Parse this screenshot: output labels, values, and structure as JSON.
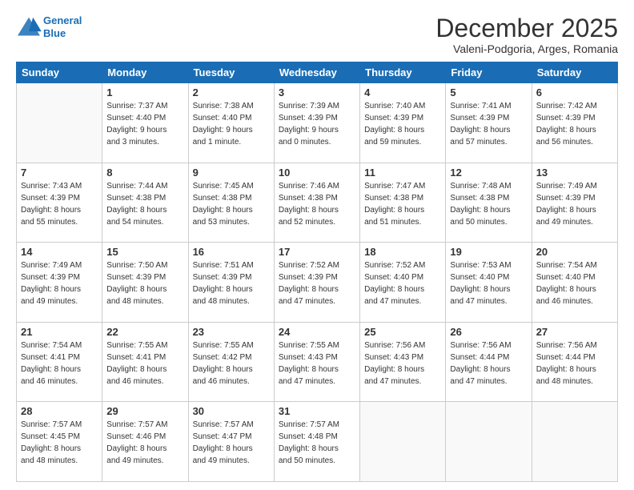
{
  "logo": {
    "line1": "General",
    "line2": "Blue"
  },
  "title": "December 2025",
  "subtitle": "Valeni-Podgoria, Arges, Romania",
  "days_of_week": [
    "Sunday",
    "Monday",
    "Tuesday",
    "Wednesday",
    "Thursday",
    "Friday",
    "Saturday"
  ],
  "weeks": [
    [
      {
        "num": "",
        "info": ""
      },
      {
        "num": "1",
        "info": "Sunrise: 7:37 AM\nSunset: 4:40 PM\nDaylight: 9 hours\nand 3 minutes."
      },
      {
        "num": "2",
        "info": "Sunrise: 7:38 AM\nSunset: 4:40 PM\nDaylight: 9 hours\nand 1 minute."
      },
      {
        "num": "3",
        "info": "Sunrise: 7:39 AM\nSunset: 4:39 PM\nDaylight: 9 hours\nand 0 minutes."
      },
      {
        "num": "4",
        "info": "Sunrise: 7:40 AM\nSunset: 4:39 PM\nDaylight: 8 hours\nand 59 minutes."
      },
      {
        "num": "5",
        "info": "Sunrise: 7:41 AM\nSunset: 4:39 PM\nDaylight: 8 hours\nand 57 minutes."
      },
      {
        "num": "6",
        "info": "Sunrise: 7:42 AM\nSunset: 4:39 PM\nDaylight: 8 hours\nand 56 minutes."
      }
    ],
    [
      {
        "num": "7",
        "info": "Sunrise: 7:43 AM\nSunset: 4:39 PM\nDaylight: 8 hours\nand 55 minutes."
      },
      {
        "num": "8",
        "info": "Sunrise: 7:44 AM\nSunset: 4:38 PM\nDaylight: 8 hours\nand 54 minutes."
      },
      {
        "num": "9",
        "info": "Sunrise: 7:45 AM\nSunset: 4:38 PM\nDaylight: 8 hours\nand 53 minutes."
      },
      {
        "num": "10",
        "info": "Sunrise: 7:46 AM\nSunset: 4:38 PM\nDaylight: 8 hours\nand 52 minutes."
      },
      {
        "num": "11",
        "info": "Sunrise: 7:47 AM\nSunset: 4:38 PM\nDaylight: 8 hours\nand 51 minutes."
      },
      {
        "num": "12",
        "info": "Sunrise: 7:48 AM\nSunset: 4:38 PM\nDaylight: 8 hours\nand 50 minutes."
      },
      {
        "num": "13",
        "info": "Sunrise: 7:49 AM\nSunset: 4:39 PM\nDaylight: 8 hours\nand 49 minutes."
      }
    ],
    [
      {
        "num": "14",
        "info": "Sunrise: 7:49 AM\nSunset: 4:39 PM\nDaylight: 8 hours\nand 49 minutes."
      },
      {
        "num": "15",
        "info": "Sunrise: 7:50 AM\nSunset: 4:39 PM\nDaylight: 8 hours\nand 48 minutes."
      },
      {
        "num": "16",
        "info": "Sunrise: 7:51 AM\nSunset: 4:39 PM\nDaylight: 8 hours\nand 48 minutes."
      },
      {
        "num": "17",
        "info": "Sunrise: 7:52 AM\nSunset: 4:39 PM\nDaylight: 8 hours\nand 47 minutes."
      },
      {
        "num": "18",
        "info": "Sunrise: 7:52 AM\nSunset: 4:40 PM\nDaylight: 8 hours\nand 47 minutes."
      },
      {
        "num": "19",
        "info": "Sunrise: 7:53 AM\nSunset: 4:40 PM\nDaylight: 8 hours\nand 47 minutes."
      },
      {
        "num": "20",
        "info": "Sunrise: 7:54 AM\nSunset: 4:40 PM\nDaylight: 8 hours\nand 46 minutes."
      }
    ],
    [
      {
        "num": "21",
        "info": "Sunrise: 7:54 AM\nSunset: 4:41 PM\nDaylight: 8 hours\nand 46 minutes."
      },
      {
        "num": "22",
        "info": "Sunrise: 7:55 AM\nSunset: 4:41 PM\nDaylight: 8 hours\nand 46 minutes."
      },
      {
        "num": "23",
        "info": "Sunrise: 7:55 AM\nSunset: 4:42 PM\nDaylight: 8 hours\nand 46 minutes."
      },
      {
        "num": "24",
        "info": "Sunrise: 7:55 AM\nSunset: 4:43 PM\nDaylight: 8 hours\nand 47 minutes."
      },
      {
        "num": "25",
        "info": "Sunrise: 7:56 AM\nSunset: 4:43 PM\nDaylight: 8 hours\nand 47 minutes."
      },
      {
        "num": "26",
        "info": "Sunrise: 7:56 AM\nSunset: 4:44 PM\nDaylight: 8 hours\nand 47 minutes."
      },
      {
        "num": "27",
        "info": "Sunrise: 7:56 AM\nSunset: 4:44 PM\nDaylight: 8 hours\nand 48 minutes."
      }
    ],
    [
      {
        "num": "28",
        "info": "Sunrise: 7:57 AM\nSunset: 4:45 PM\nDaylight: 8 hours\nand 48 minutes."
      },
      {
        "num": "29",
        "info": "Sunrise: 7:57 AM\nSunset: 4:46 PM\nDaylight: 8 hours\nand 49 minutes."
      },
      {
        "num": "30",
        "info": "Sunrise: 7:57 AM\nSunset: 4:47 PM\nDaylight: 8 hours\nand 49 minutes."
      },
      {
        "num": "31",
        "info": "Sunrise: 7:57 AM\nSunset: 4:48 PM\nDaylight: 8 hours\nand 50 minutes."
      },
      {
        "num": "",
        "info": ""
      },
      {
        "num": "",
        "info": ""
      },
      {
        "num": "",
        "info": ""
      }
    ]
  ]
}
